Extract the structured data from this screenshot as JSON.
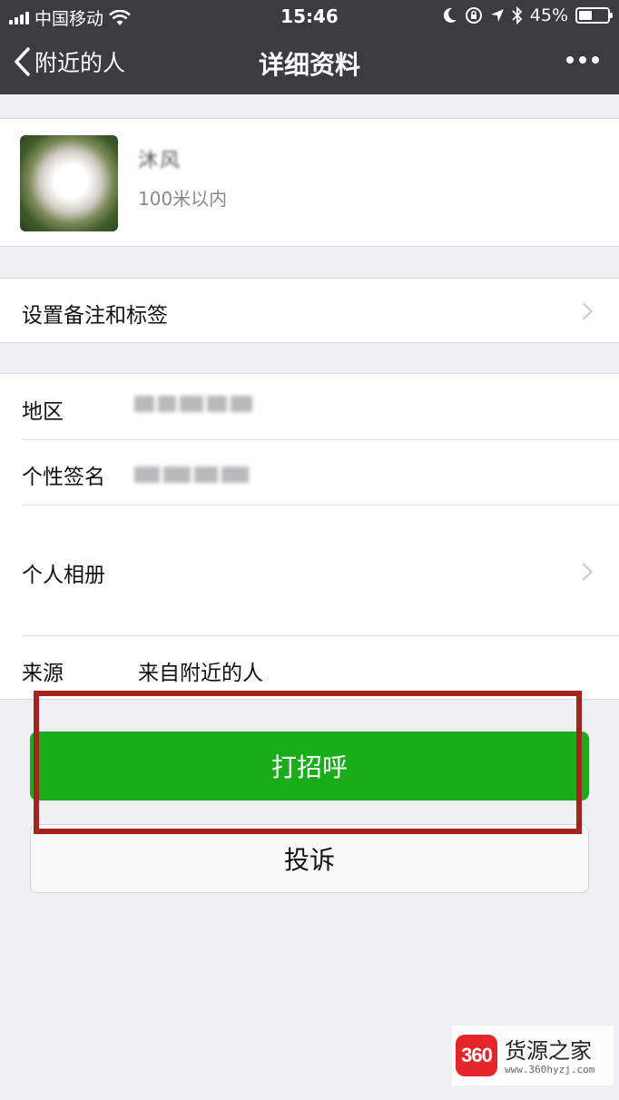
{
  "status_bar": {
    "carrier": "中国移动",
    "time": "15:46",
    "battery_percent": "45%",
    "battery_level": 0.45,
    "icons": [
      "signal-icon",
      "wifi-icon",
      "moon-icon",
      "rotation-lock-icon",
      "location-icon",
      "bluetooth-icon",
      "battery-icon"
    ]
  },
  "nav": {
    "back_label": "附近的人",
    "title": "详细资料",
    "more_icon": "more-icon"
  },
  "profile": {
    "nickname": "沐风",
    "distance": "100米以内"
  },
  "remark_row": {
    "label": "设置备注和标签"
  },
  "info": {
    "region_label": "地区",
    "signature_label": "个性签名",
    "album_label": "个人相册",
    "source_label": "来源",
    "source_value": "来自附近的人"
  },
  "actions": {
    "greet_label": "打招呼",
    "report_label": "投诉"
  },
  "colors": {
    "nav_bg": "#3c3b40",
    "primary_green": "#1aad19",
    "annotation_red": "#a4231e",
    "page_bg": "#efeff4"
  },
  "watermark": {
    "logo_text": "360",
    "name": "货源之家",
    "url": "www.360hyzj.com"
  }
}
